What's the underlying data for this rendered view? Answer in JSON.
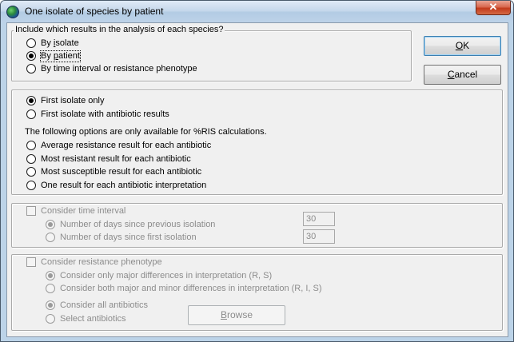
{
  "window": {
    "title": "One isolate of species by patient",
    "close_label": "✕",
    "app_icon": "globe-icon"
  },
  "include_group": {
    "caption": "Include which results in the analysis of each species?",
    "options": [
      {
        "pre": "By ",
        "key": "i",
        "post": "solate",
        "checked": false
      },
      {
        "pre": "By ",
        "key": "p",
        "post": "atient",
        "checked": true
      },
      {
        "pre": "By time interval or resistance phenotype",
        "key": "",
        "post": "",
        "checked": false
      }
    ]
  },
  "buttons": {
    "ok": {
      "key": "O",
      "rest": "K"
    },
    "cancel": {
      "key": "C",
      "rest": "ancel"
    }
  },
  "isolate_group": {
    "options": [
      {
        "label": "First isolate only",
        "checked": true
      },
      {
        "label": "First isolate with antibiotic results",
        "checked": false
      }
    ],
    "note": "The following options are only available for %RIS calculations.",
    "ris_options": [
      {
        "label": "Average resistance result for each antibiotic",
        "checked": false
      },
      {
        "label": "Most resistant result for each antibiotic",
        "checked": false
      },
      {
        "label": "Most susceptible result for each antibiotic",
        "checked": false
      },
      {
        "label": "One result for each antibiotic interpretation",
        "checked": false
      }
    ]
  },
  "time_group": {
    "checkbox_label": "Consider time interval",
    "options": [
      {
        "label": "Number of days since previous isolation",
        "checked": true,
        "value": "30"
      },
      {
        "label": "Number of days since first isolation",
        "checked": false,
        "value": "30"
      }
    ]
  },
  "phenotype_group": {
    "checkbox_label": "Consider resistance phenotype",
    "diff_options": [
      {
        "label": "Consider only major differences in interpretation (R, S)",
        "checked": true
      },
      {
        "label": "Consider both major and minor differences in interpretation (R, I, S)",
        "checked": false
      }
    ],
    "abx_options": [
      {
        "label": "Consider all antibiotics",
        "checked": true
      },
      {
        "label": "Select antibiotics",
        "checked": false
      }
    ],
    "browse": {
      "key": "B",
      "rest": "rowse"
    }
  }
}
